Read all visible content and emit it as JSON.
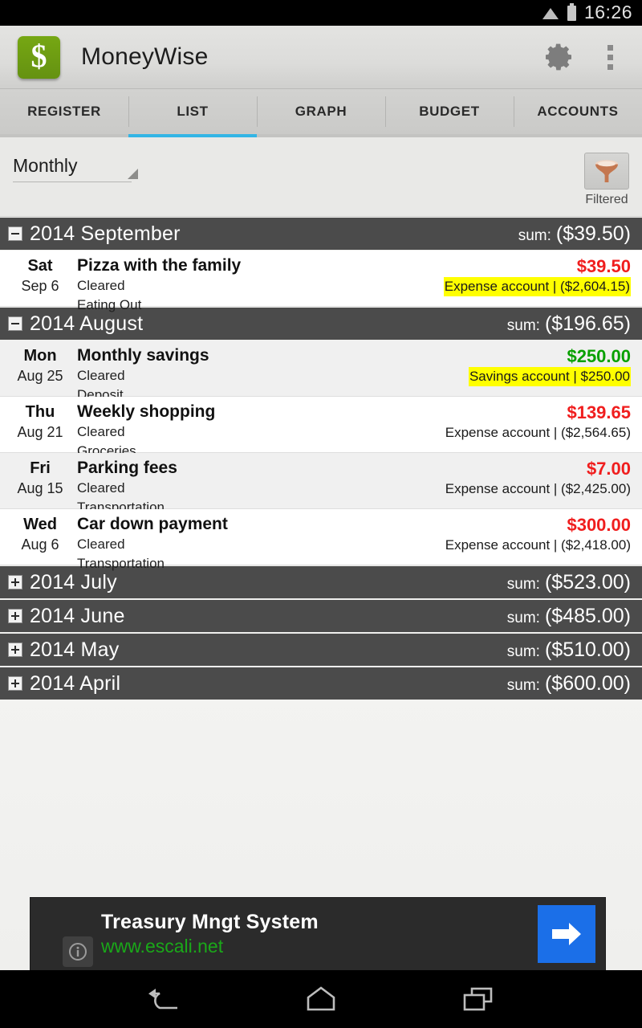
{
  "statusbar": {
    "time": "16:26",
    "wifi_icon": "wifi-icon",
    "battery_icon": "battery-icon"
  },
  "actionbar": {
    "app_icon": "dollar-app-icon",
    "app_icon_glyph": "$",
    "title": "MoneyWise",
    "settings_icon": "gear-icon",
    "overflow_icon": "overflow-menu-icon"
  },
  "tabs": [
    {
      "label": "REGISTER",
      "active": false
    },
    {
      "label": "LIST",
      "active": true
    },
    {
      "label": "GRAPH",
      "active": false
    },
    {
      "label": "BUDGET",
      "active": false
    },
    {
      "label": "ACCOUNTS",
      "active": false
    }
  ],
  "filterbar": {
    "spinner_value": "Monthly",
    "filter_icon": "funnel-icon",
    "filtered_label": "Filtered"
  },
  "list": {
    "sum_label": "sum:",
    "groups": [
      {
        "title": "2014 September",
        "sum": "($39.50)",
        "expanded": true,
        "transactions": [
          {
            "dow": "Sat",
            "day": "Sep 6",
            "title": "Pizza with the family",
            "status": "Cleared",
            "category": "Eating Out",
            "amount": "$39.50",
            "amount_sign": "neg",
            "account": "Expense account | ($2,604.15)",
            "account_highlighted": true
          }
        ]
      },
      {
        "title": "2014 August",
        "sum": "($196.65)",
        "expanded": true,
        "transactions": [
          {
            "dow": "Mon",
            "day": "Aug 25",
            "title": "Monthly savings",
            "status": "Cleared",
            "category": "Deposit",
            "amount": "$250.00",
            "amount_sign": "pos",
            "account": "Savings account | $250.00",
            "account_highlighted": true
          },
          {
            "dow": "Thu",
            "day": "Aug 21",
            "title": "Weekly shopping",
            "status": "Cleared",
            "category": "Groceries",
            "amount": "$139.65",
            "amount_sign": "neg",
            "account": "Expense account | ($2,564.65)",
            "account_highlighted": false
          },
          {
            "dow": "Fri",
            "day": "Aug 15",
            "title": "Parking fees",
            "status": "Cleared",
            "category": "Transportation",
            "amount": "$7.00",
            "amount_sign": "neg",
            "account": "Expense account | ($2,425.00)",
            "account_highlighted": false
          },
          {
            "dow": "Wed",
            "day": "Aug 6",
            "title": "Car down payment",
            "status": "Cleared",
            "category": "Transportation",
            "amount": "$300.00",
            "amount_sign": "neg",
            "account": "Expense account | ($2,418.00)",
            "account_highlighted": false
          }
        ]
      },
      {
        "title": "2014 July",
        "sum": "($523.00)",
        "expanded": false,
        "transactions": []
      },
      {
        "title": "2014 June",
        "sum": "($485.00)",
        "expanded": false,
        "transactions": []
      },
      {
        "title": "2014 May",
        "sum": "($510.00)",
        "expanded": false,
        "transactions": []
      },
      {
        "title": "2014 April",
        "sum": "($600.00)",
        "expanded": false,
        "transactions": []
      }
    ]
  },
  "ad": {
    "title": "Treasury Mngt System",
    "url": "www.escali.net",
    "cta_icon": "arrow-right-icon",
    "info_icon": "info-icon"
  },
  "navbar": {
    "back_icon": "back-icon",
    "home_icon": "home-icon",
    "recents_icon": "recents-icon"
  },
  "colors": {
    "accent_blue": "#33b5e5",
    "group_header_bg": "#4b4b4b",
    "negative": "#f01e1e",
    "positive": "#08a000",
    "highlight": "#ffff00",
    "app_green": "#76a713",
    "ad_link_green": "#1aa819",
    "cta_blue": "#1b6fe8"
  }
}
